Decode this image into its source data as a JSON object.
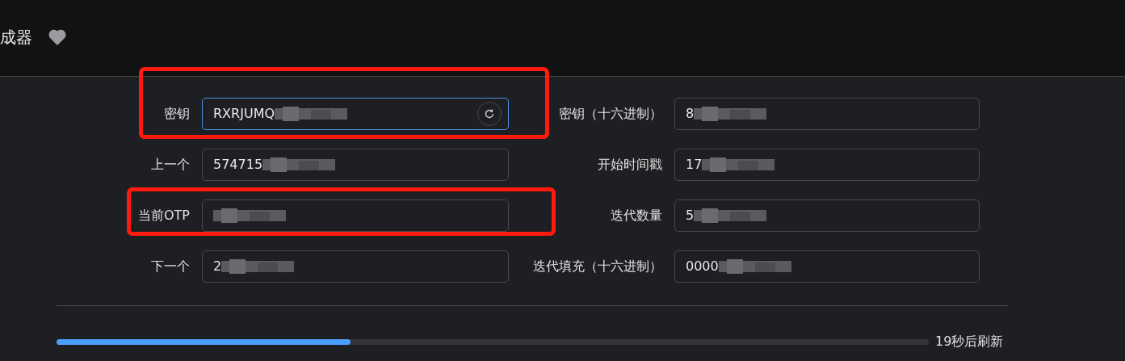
{
  "header": {
    "title": "成器",
    "favorite": true
  },
  "fields": [
    {
      "label": "密钥",
      "value": "RXRJUMQ",
      "redacted": true,
      "focused": true,
      "highlighted": true,
      "refresh_button": true
    },
    {
      "label": "密钥（十六进制）",
      "value": "8",
      "redacted": true,
      "focused": false
    },
    {
      "label": "上一个",
      "value": "574715",
      "redacted": true,
      "focused": false
    },
    {
      "label": "开始时间戳",
      "value": "17",
      "redacted": true,
      "focused": false
    },
    {
      "label": "当前OTP",
      "redacted": true,
      "focused": false,
      "highlighted": true
    },
    {
      "label": "迭代数量",
      "value": "5",
      "redacted": true,
      "focused": false
    },
    {
      "label": "下一个",
      "value": "2",
      "redacted": true,
      "focused": false
    },
    {
      "label": "迭代填充（十六进制）",
      "value": "0000",
      "redacted": true,
      "focused": false
    }
  ],
  "progress": {
    "level": 0.337,
    "label": "19秒后刷新"
  }
}
